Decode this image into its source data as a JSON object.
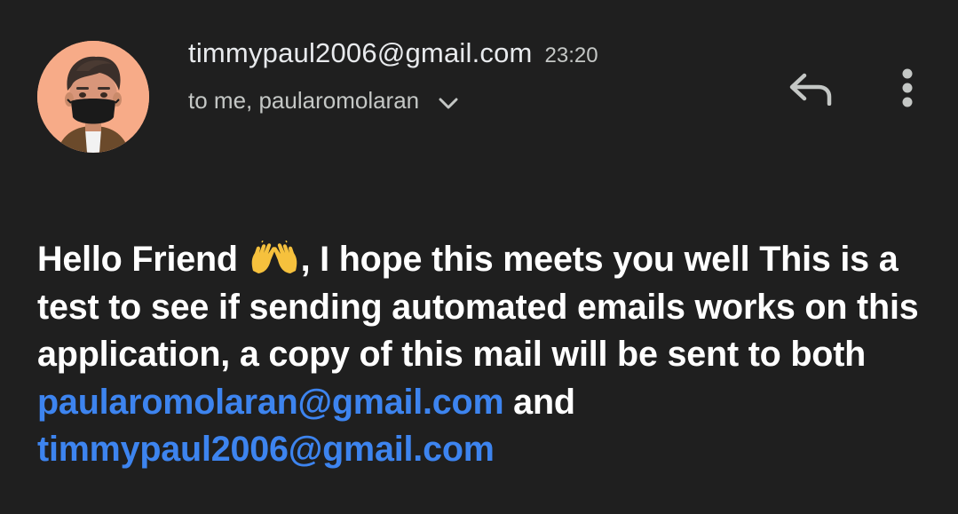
{
  "header": {
    "sender_email": "timmypaul2006@gmail.com",
    "time": "23:20",
    "recipients": "to me, paularomolaran",
    "avatar_icon": "memoji-avatar-masked-man",
    "expand_icon": "chevron-down-icon",
    "reply_icon": "reply-arrow-icon",
    "more_icon": "vertical-dots-icon"
  },
  "message": {
    "greeting": "Hello Friend",
    "emoji": "🙌",
    "emoji_icon": "raising-hands-emoji",
    "text_part1": ", I hope this meets you well This is a test to see if sending automated emails works on this application, a copy of this mail will be sent to both ",
    "link1": "paularomolaran@gmail.com",
    "text_part2": " and ",
    "link2": "timmypaul2006@gmail.com"
  },
  "colors": {
    "background": "#1f1f1f",
    "link": "#3d84ef",
    "text": "#ffffff",
    "secondary_text": "#c4c7c5"
  }
}
